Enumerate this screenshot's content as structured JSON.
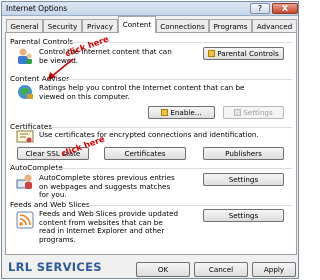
{
  "window": {
    "title": "Internet Options",
    "help_label": "?",
    "close_label": "X"
  },
  "tabs": [
    "General",
    "Security",
    "Privacy",
    "Content",
    "Connections",
    "Programs",
    "Advanced"
  ],
  "parental": {
    "title": "Parental Controls",
    "description_line1": "Control the Internet content that can",
    "description_line2": "be viewed.",
    "button": "Parental Controls",
    "annotation": "click here"
  },
  "advisor": {
    "title": "Content Advisor",
    "description_line1": "Ratings help you control the Internet content that can be",
    "description_line2": "viewed on this computer.",
    "enable_button": "Enable...",
    "settings_button": "Settings"
  },
  "certificates": {
    "title": "Certificates",
    "description": "Use certificates for encrypted connections and identification.",
    "clear_ssl_button": "Clear SSL state",
    "certificates_button": "Certificates",
    "publishers_button": "Publishers",
    "annotation": "click here"
  },
  "autocomplete": {
    "title": "AutoComplete",
    "description_line1": "AutoComplete stores previous entries",
    "description_line2": "on webpages and suggests matches",
    "description_line3": "for you.",
    "settings_button": "Settings"
  },
  "feeds": {
    "title": "Feeds and Web Slices",
    "description_line1": "Feeds and Web Slices provide updated",
    "description_line2": "content from websites that can be",
    "description_line3": "read in Internet Explorer and other",
    "description_line4": "programs.",
    "settings_button": "Settings"
  },
  "footer": {
    "brand": "LRL SERVICES",
    "ok": "OK",
    "cancel": "Cancel",
    "apply": "Apply"
  }
}
